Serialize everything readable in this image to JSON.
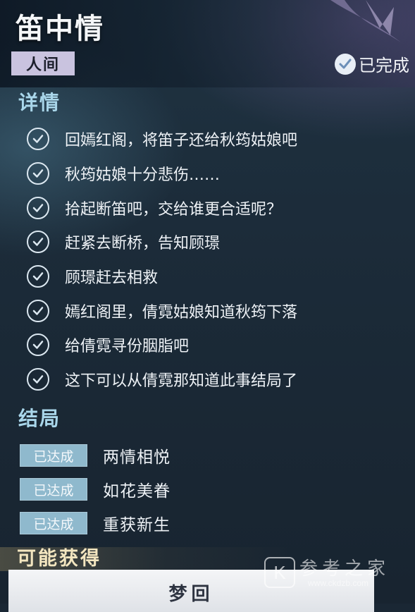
{
  "quest": {
    "title": "笛中情",
    "category": "人间",
    "status_label": "已完成"
  },
  "details": {
    "heading": "详情",
    "steps": [
      "回嫣红阁，将笛子还给秋筠姑娘吧",
      "秋筠姑娘十分悲伤……",
      "拾起断笛吧，交给谁更合适呢？",
      "赶紧去断桥，告知顾璟",
      "顾璟赶去相救",
      "嫣红阁里，倩霓姑娘知道秋筠下落",
      "给倩霓寻份胭脂吧",
      "这下可以从倩霓那知道此事结局了"
    ]
  },
  "endings": {
    "heading": "结局",
    "items": [
      {
        "badge": "已达成",
        "name": "两情相悦"
      },
      {
        "badge": "已达成",
        "name": "如花美眷"
      },
      {
        "badge": "已达成",
        "name": "重获新生"
      }
    ]
  },
  "rewards": {
    "heading": "可能获得"
  },
  "footer": {
    "button_label": "梦回"
  },
  "watermark": {
    "logo_letter": "K",
    "text": "参考之家",
    "url": "www.ckdzb.com"
  },
  "icons": {
    "step_icon": "check-circle-icon",
    "status_icon": "check-circle-icon",
    "decoration": "feather-icon"
  }
}
